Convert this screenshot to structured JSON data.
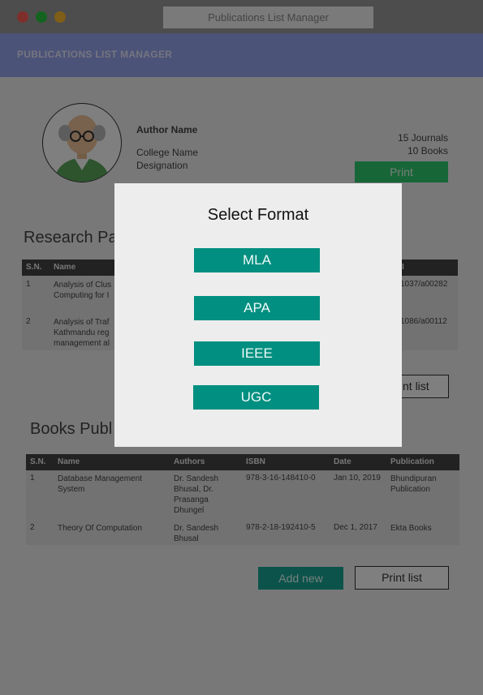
{
  "window": {
    "title": "Publications List Manager",
    "dot_colors": [
      "#ff5f57",
      "#28c840",
      "#febc2e"
    ]
  },
  "app": {
    "title": "PUBLICATIONS LIST MANAGER"
  },
  "profile": {
    "author_name": "Author Name",
    "college_name": "College Name",
    "designation": "Designation",
    "journals_count": "15 Journals",
    "books_count": "10 Books",
    "print_label": "Print"
  },
  "research": {
    "title": "Research Pa",
    "headers": [
      "S.N.",
      "Name",
      "I"
    ],
    "rows": [
      {
        "sn": "1",
        "name": "Analysis of Clus\nComputing for I",
        "doi": "1037/a00282"
      },
      {
        "sn": "2",
        "name": "Analysis of Traf\nKathmandu reg\nmanagement al",
        "doi": "1086/a00112"
      }
    ],
    "print_list_label": "nt list"
  },
  "books": {
    "title": "Books Publ",
    "headers": [
      "S.N.",
      "Name",
      "Authors",
      "ISBN",
      "Date",
      "Publication"
    ],
    "rows": [
      {
        "sn": "1",
        "name": "Database Management System",
        "authors": "Dr. Sandesh Bhusal, Dr. Prasanga Dhungel",
        "isbn": "978-3-16-148410-0",
        "date": "Jan 10, 2019",
        "publication": "Bhundipuran Publication"
      },
      {
        "sn": "2",
        "name": "Theory Of Computation",
        "authors": "Dr. Sandesh Bhusal",
        "isbn": "978-2-18-192410-5",
        "date": "Dec 1, 2017",
        "publication": "Ekta Books"
      }
    ],
    "add_new_label": "Add new",
    "print_list_label": "Print list"
  },
  "modal": {
    "title": "Select Format",
    "options": [
      "MLA",
      "APA",
      "IEEE",
      "UGC"
    ]
  }
}
